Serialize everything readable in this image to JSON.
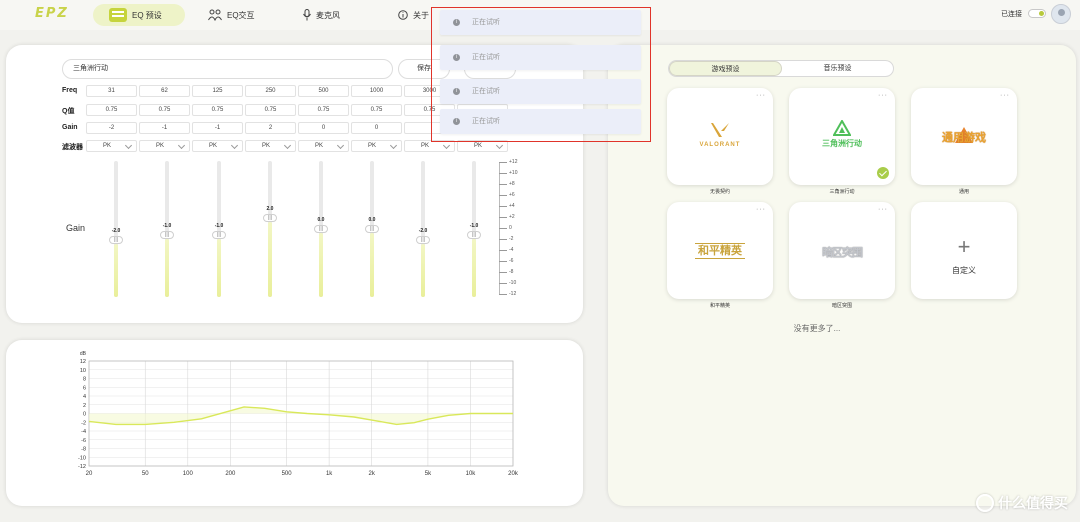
{
  "app": {
    "logo": "EPZ",
    "connection_status": "已连接"
  },
  "nav": {
    "eq_preset": "EQ 预设",
    "eq_interact": "EQ交互",
    "mic": "麦克风",
    "about": "关于"
  },
  "eq": {
    "preset_name": "三角洲行动",
    "save_label": "保存",
    "row_labels": {
      "freq": "Freq",
      "q": "Q值",
      "gain": "Gain",
      "filter": "滤波器"
    },
    "freq": [
      "31",
      "62",
      "125",
      "250",
      "500",
      "1000",
      "3000",
      ""
    ],
    "q": [
      "0.75",
      "0.75",
      "0.75",
      "0.75",
      "0.75",
      "0.75",
      "0.75",
      ""
    ],
    "gain": [
      "-2",
      "-1",
      "-1",
      "2",
      "0",
      "0",
      "",
      ""
    ],
    "filter": [
      "PK",
      "PK",
      "PK",
      "PK",
      "PK",
      "PK",
      "PK",
      "PK"
    ],
    "gain_side_label": "Gain",
    "slider_values": [
      -2.0,
      -1.0,
      -1.0,
      2.0,
      0.0,
      0.0,
      -2.0,
      -1.0
    ],
    "slider_labels": [
      "-2.0",
      "-1.0",
      "-1.0",
      "2.0",
      "0.0",
      "0.0",
      "-2.0",
      "-1.0"
    ],
    "scale_labels": [
      "+12",
      "+10",
      "+8",
      "+6",
      "+4",
      "+2",
      "0",
      "-2",
      "-4",
      "-6",
      "-8",
      "-10",
      "-12"
    ]
  },
  "chart_data": {
    "type": "line",
    "title": "",
    "xlabel": "",
    "ylabel": "dB",
    "x_scale": "log",
    "xlim": [
      20,
      20000
    ],
    "ylim": [
      -12,
      12
    ],
    "x_ticks": [
      "20",
      "50",
      "100",
      "200",
      "500",
      "1k",
      "2k",
      "5k",
      "10k",
      "20k"
    ],
    "y_ticks": [
      "12",
      "10",
      "8",
      "6",
      "4",
      "2",
      "0",
      "-2",
      "-4",
      "-6",
      "-8",
      "-10",
      "-12"
    ],
    "grid": true,
    "series": [
      {
        "color": "#d9e85a",
        "x": [
          20,
          31,
          50,
          80,
          125,
          180,
          250,
          350,
          500,
          700,
          1000,
          1500,
          2000,
          3000,
          4000,
          5000,
          7000,
          10000,
          15000,
          20000
        ],
        "y": [
          -1.8,
          -2.5,
          -2.5,
          -2.0,
          -1.2,
          0.2,
          1.5,
          1.2,
          0.4,
          0.0,
          -0.3,
          -0.8,
          -1.5,
          -2.5,
          -2.1,
          -1.3,
          -0.4,
          0.0,
          0.0,
          0.0
        ]
      }
    ]
  },
  "presets": {
    "tabs": [
      "游戏预设",
      "音乐预设"
    ],
    "more_label": "···",
    "cards": [
      {
        "name": "无畏契约",
        "logo": "VALORANT",
        "selected": false
      },
      {
        "name": "三角洲行动",
        "logo": "三角洲行动",
        "selected": true
      },
      {
        "name": "通用",
        "logo": "通用游戏",
        "selected": false
      },
      {
        "name": "和平精英",
        "logo": "和平精英",
        "selected": false
      },
      {
        "name": "暗区突围",
        "logo": "暗区突围",
        "selected": false
      }
    ],
    "custom": {
      "plus": "+",
      "label": "自定义"
    },
    "no_more": "没有更多了..."
  },
  "toasts": [
    "正在试听",
    "正在试听",
    "正在试听",
    "正在试听"
  ],
  "watermark": "什么值得买",
  "colors": {
    "accent": "#c6d43d",
    "overlay_border": "#e0342a",
    "curve": "#d9e85a"
  }
}
